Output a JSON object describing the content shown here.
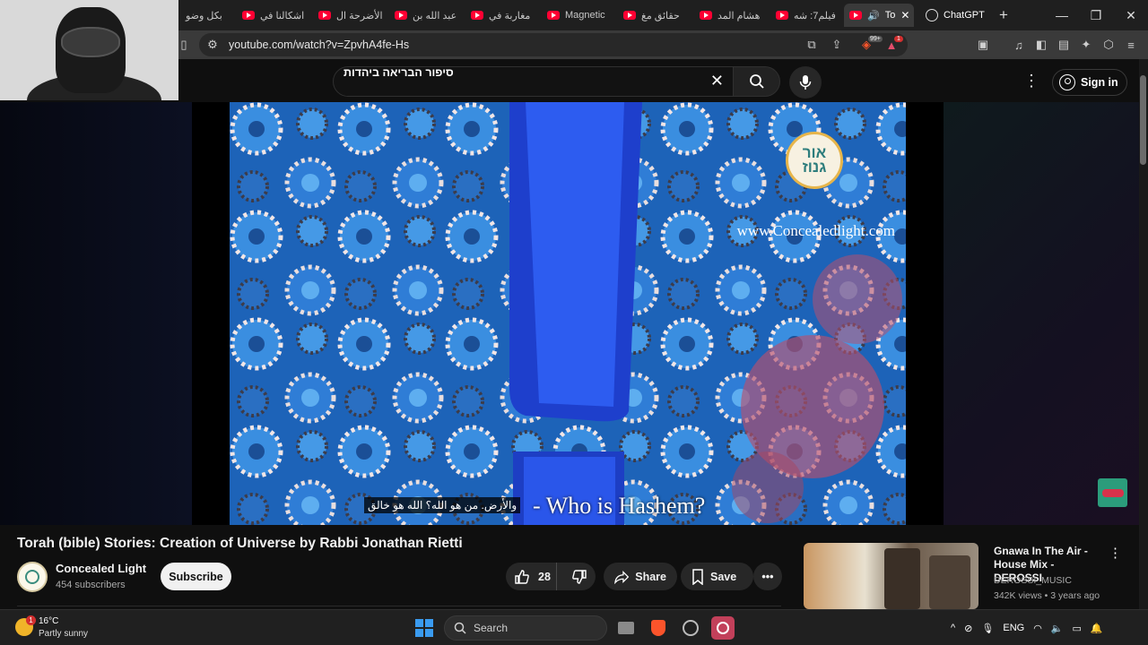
{
  "browser": {
    "tabs": [
      {
        "label": "بكل وضو"
      },
      {
        "label": "اشكالنا في"
      },
      {
        "label": "الأضرحة ال"
      },
      {
        "label": "عبد الله بن"
      },
      {
        "label": "مغاربة في"
      },
      {
        "label": "Magnetic"
      },
      {
        "label": "حقائق مغ"
      },
      {
        "label": "هشام المد"
      },
      {
        "label": "فيلم7: شه"
      },
      {
        "label": "To"
      },
      {
        "label": "ChatGPT"
      }
    ],
    "new_tab": "+",
    "url": "youtube.com/watch?v=ZpvhA4fe-Hs",
    "brave_badge": "99+",
    "alert_badge": "1"
  },
  "youtube": {
    "search_query": "סיפור הבריאה ביהדות",
    "sign_in": "Sign in"
  },
  "video": {
    "watermark": "www.Concealedlight.com",
    "logo_text": "אור גנוז",
    "subtitle": "- Who is Hashem?",
    "caption_arabic": "والأرض. من هو الله؟ الله هو خالق",
    "title": "Torah (bible) Stories: Creation of Universe by Rabbi Jonathan Rietti",
    "channel": "Concealed Light",
    "subscribers": "454 subscribers",
    "subscribe_label": "Subscribe",
    "likes": "28",
    "share_label": "Share",
    "save_label": "Save"
  },
  "related": {
    "title": "Gnawa In The Air - House Mix - DEROSSI",
    "channel": "DEROSSI_MUSIC",
    "meta": "342K views • 3 years ago"
  },
  "taskbar": {
    "temperature": "16°C",
    "condition": "Partly sunny",
    "weather_badge": "1",
    "search_label": "Search",
    "language": "ENG"
  }
}
